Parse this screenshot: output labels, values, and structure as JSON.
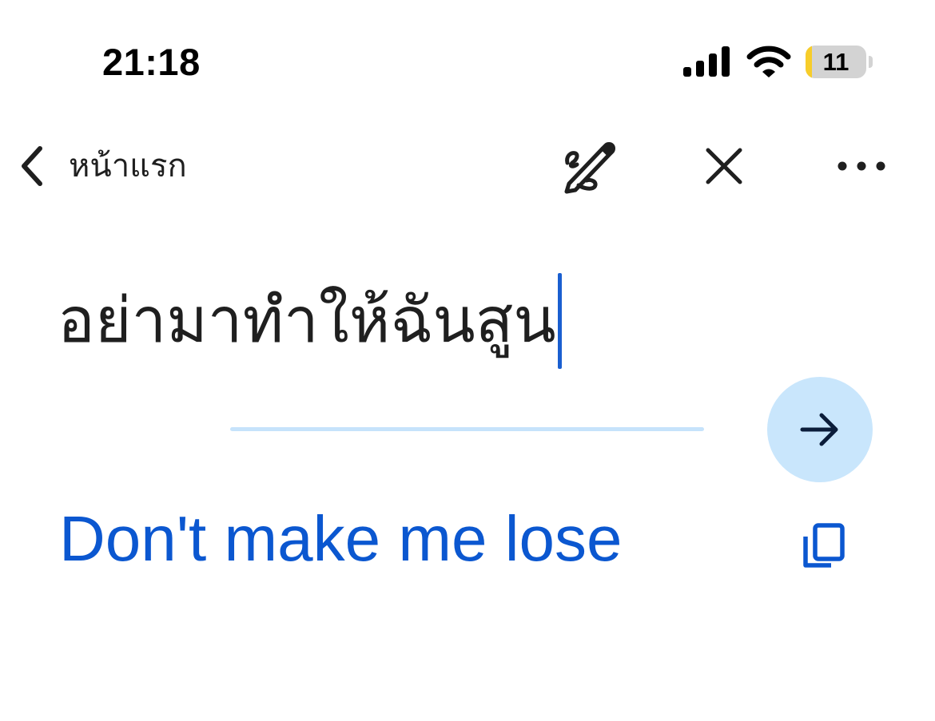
{
  "status_bar": {
    "time": "21:18",
    "battery_level": "11",
    "battery_fraction": 0.11,
    "battery_low_color": "#f7cd2a",
    "icons": [
      "signal-icon",
      "wifi-icon",
      "battery-icon"
    ]
  },
  "nav": {
    "back_label": "หน้าแรก",
    "actions": [
      "handwriting-icon",
      "close-icon",
      "more-icon"
    ]
  },
  "input": {
    "text": "อย่ามาทำให้ฉันสูน",
    "caret_color": "#1a5fd0"
  },
  "translate": {
    "button_icon": "arrow-right-icon",
    "button_color": "#c9e6fc"
  },
  "result": {
    "text": "Don't make me lose",
    "color": "#0b57d0",
    "copy_icon": "copy-icon"
  }
}
